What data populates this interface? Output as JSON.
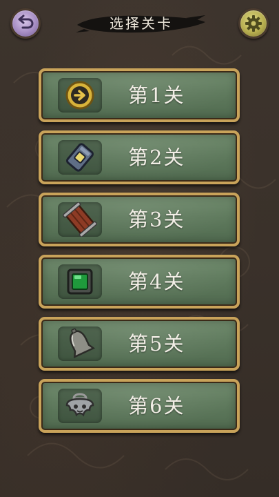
{
  "header": {
    "title": "选择关卡",
    "back_icon": "back-arrow-icon",
    "settings_icon": "gear-icon"
  },
  "levels": [
    {
      "label": "第1关",
      "icon": "gold-coin-arrow-icon"
    },
    {
      "label": "第2关",
      "icon": "lock-tag-icon"
    },
    {
      "label": "第3关",
      "icon": "wooden-crate-icon"
    },
    {
      "label": "第4关",
      "icon": "green-gem-icon"
    },
    {
      "label": "第5关",
      "icon": "bell-icon"
    },
    {
      "label": "第6关",
      "icon": "silver-amulet-icon"
    }
  ],
  "colors": {
    "background": "#3a312a",
    "panel": "#5f7a5d",
    "panel_border": "#c9a35a",
    "text": "#f2eee6"
  }
}
